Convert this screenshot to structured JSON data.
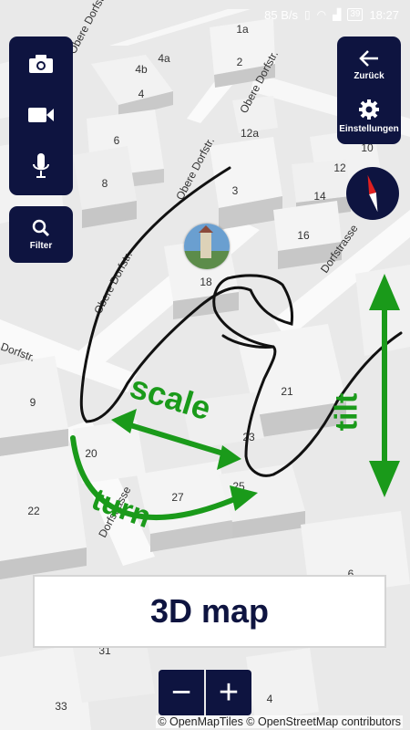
{
  "status_bar": {
    "speed": "85 B/s",
    "battery": "39",
    "time": "18:27"
  },
  "top_left_panel": {
    "camera_icon": "camera-icon",
    "video_icon": "video-camera-icon",
    "mic_icon": "microphone-icon"
  },
  "filter": {
    "icon": "search-icon",
    "label": "Filter"
  },
  "top_right_panel": {
    "back_label": "Zurück",
    "settings_label": "Einstellungen"
  },
  "map": {
    "streets": [
      "Obere Dorfstr.",
      "Obere Dorfstr.",
      "Obere Dorfstr.",
      "Dorfstrasse",
      "Dorfstr.",
      "Dorfstrasse"
    ],
    "house_numbers": [
      "1a",
      "4a",
      "4b",
      "2",
      "4",
      "6",
      "12a",
      "10",
      "12",
      "8",
      "14",
      "3",
      "16",
      "18",
      "9",
      "21",
      "23",
      "20",
      "27",
      "25",
      "22",
      "6",
      "31",
      "33",
      "4"
    ]
  },
  "overlay_labels": {
    "scale": "scale",
    "turn": "turn",
    "tilt": "tilt"
  },
  "title_banner": "3D map",
  "zoom": {
    "minus": "−",
    "plus": "+"
  },
  "attribution": "© OpenMapTiles © OpenStreetMap contributors",
  "colors": {
    "panel": "#0e1440",
    "gesture_green": "#1a9a1a",
    "compass_red": "#e02020"
  }
}
